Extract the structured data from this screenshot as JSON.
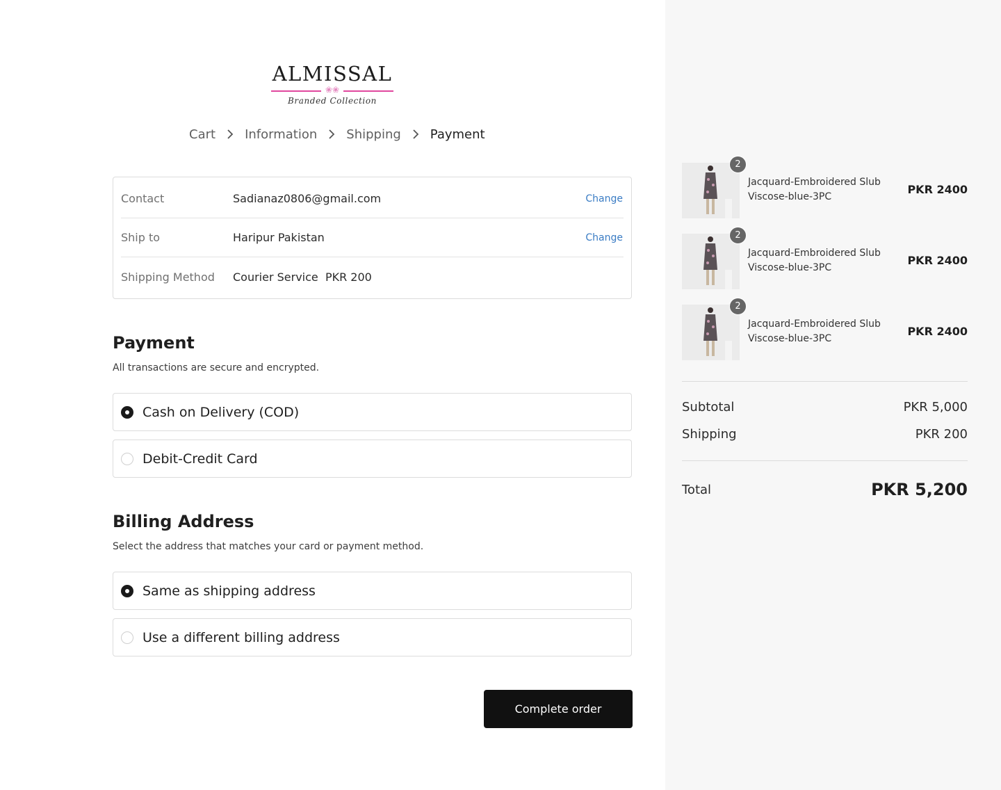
{
  "brand": {
    "name": "ALMISSAL",
    "tagline": "Branded Collection",
    "accent_color": "#e0479e"
  },
  "breadcrumb": {
    "items": [
      "Cart",
      "Information",
      "Shipping",
      "Payment"
    ],
    "current": "Payment"
  },
  "review": {
    "rows": [
      {
        "label": "Contact",
        "value": "Sadianaz0806@gmail.com",
        "action": "Change"
      },
      {
        "label": "Ship to",
        "value": "Haripur Pakistan",
        "action": "Change"
      },
      {
        "label": "Shipping Method",
        "value": "Courier Service  PKR 200"
      }
    ]
  },
  "payment": {
    "title": "Payment",
    "subtitle": "All transactions are secure and encrypted.",
    "options": [
      {
        "label": "Cash on Delivery (COD)",
        "selected": true
      },
      {
        "label": "Debit-Credit Card",
        "selected": false
      }
    ]
  },
  "billing": {
    "title": "Billing Address",
    "subtitle": "Select the address that matches your card or payment method.",
    "options": [
      {
        "label": "Same as shipping address",
        "selected": true
      },
      {
        "label": "Use a different billing address",
        "selected": false
      }
    ]
  },
  "actions": {
    "complete_label": "Complete order"
  },
  "summary": {
    "items": [
      {
        "name": "Jacquard-Embroidered Slub Viscose-blue-3PC",
        "qty": "2",
        "price": "PKR 2400"
      },
      {
        "name": "Jacquard-Embroidered Slub Viscose-blue-3PC",
        "qty": "2",
        "price": "PKR 2400"
      },
      {
        "name": "Jacquard-Embroidered Slub Viscose-blue-3PC",
        "qty": "2",
        "price": "PKR 2400"
      }
    ],
    "subtotal_label": "Subtotal",
    "subtotal_value": "PKR 5,000",
    "shipping_label": "Shipping",
    "shipping_value": "PKR 200",
    "total_label": "Total",
    "total_value": "PKR 5,200"
  }
}
